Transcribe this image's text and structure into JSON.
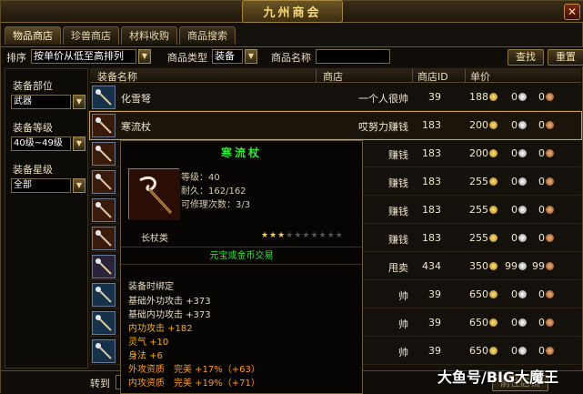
{
  "window": {
    "title": "九州商会",
    "close_label": "✕"
  },
  "tabs": [
    "物品商店",
    "珍兽商店",
    "材料收购",
    "商品搜索"
  ],
  "filter": {
    "sort_label": "排序",
    "sort_value": "按单价从低至高排列",
    "type_label": "商品类型",
    "type_value": "装备",
    "name_label": "商品名称",
    "name_value": "",
    "search_button": "查找",
    "reset_button": "重置"
  },
  "sidebar": {
    "part_label": "装备部位",
    "part_value": "武器",
    "level_label": "装备等级",
    "level_value": "40级~49级",
    "star_label": "装备星级",
    "star_value": "全部"
  },
  "table": {
    "headers": [
      "装备名称",
      "商店",
      "商店ID",
      "单价"
    ],
    "rows": [
      {
        "name": "化雪弩",
        "shop": "一个人很帅",
        "id": "39",
        "gold": "188",
        "silver": "0",
        "copper": "0"
      },
      {
        "name": "寒流杖",
        "shop": "哎努力赚钱",
        "id": "183",
        "gold": "200",
        "silver": "0",
        "copper": "0"
      },
      {
        "name": "",
        "shop": "赚钱",
        "id": "183",
        "gold": "200",
        "silver": "0",
        "copper": "0"
      },
      {
        "name": "",
        "shop": "赚钱",
        "id": "183",
        "gold": "255",
        "silver": "0",
        "copper": "0"
      },
      {
        "name": "",
        "shop": "赚钱",
        "id": "183",
        "gold": "255",
        "silver": "0",
        "copper": "0"
      },
      {
        "name": "",
        "shop": "赚钱",
        "id": "183",
        "gold": "255",
        "silver": "0",
        "copper": "0"
      },
      {
        "name": "",
        "shop": "甩卖",
        "id": "434",
        "gold": "350",
        "silver": "99",
        "copper": "99"
      },
      {
        "name": "",
        "shop": "帅",
        "id": "39",
        "gold": "650",
        "silver": "0",
        "copper": "0"
      },
      {
        "name": "",
        "shop": "帅",
        "id": "39",
        "gold": "650",
        "silver": "0",
        "copper": "0"
      },
      {
        "name": "",
        "shop": "帅",
        "id": "39",
        "gold": "650",
        "silver": "0",
        "copper": "0"
      }
    ]
  },
  "footer": {
    "goto_label": "转到",
    "right_text": "前往店铺"
  },
  "tooltip": {
    "name": "寒流杖",
    "level": "等级：40",
    "durability": "耐久：162/162",
    "repairs": "可修理次数：3/3",
    "type": "长杖类",
    "stars_filled": 3,
    "stars_total": 10,
    "trade": "元宝或金币交易",
    "bind": "装备时绑定",
    "attrs": [
      {
        "text": "基础外功攻击 +373",
        "color": "#e8dcc0"
      },
      {
        "text": "基础内功攻击 +373",
        "color": "#e8dcc0"
      },
      {
        "text": "内功攻击 +182",
        "color": "#ffb000"
      },
      {
        "text": "灵气 +10",
        "color": "#ffb000"
      },
      {
        "text": "身法 +6",
        "color": "#ffb000"
      },
      {
        "text": "外攻资质　完美 +17%（+63）",
        "color": "#ff9a1a"
      },
      {
        "text": "内攻资质　完美 +19%（+71）",
        "color": "#ff9a1a"
      }
    ]
  },
  "watermark": "大鱼号/BIG大魔王",
  "colors": {
    "accent_gold": "#f3d77a",
    "green_text": "#2ee83a",
    "orange_text": "#ffb000"
  }
}
